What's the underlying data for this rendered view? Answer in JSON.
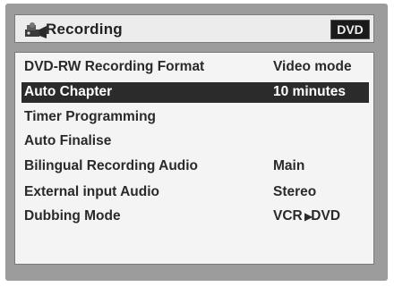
{
  "header": {
    "title": "Recording",
    "icon": "recording-menu-icon",
    "badge": "DVD"
  },
  "menu": {
    "items": [
      {
        "label": "DVD-RW Recording Format",
        "value": "Video mode",
        "selected": false
      },
      {
        "label": "Auto Chapter",
        "value": "10 minutes",
        "selected": true
      },
      {
        "label": "Timer Programming",
        "value": "",
        "selected": false
      },
      {
        "label": "Auto Finalise",
        "value": "",
        "selected": false
      },
      {
        "label": "Bilingual Recording Audio",
        "value": "Main",
        "selected": false
      },
      {
        "label": "External input Audio",
        "value": "Stereo",
        "selected": false
      },
      {
        "label": "Dubbing Mode",
        "value_prefix": "VCR",
        "value_arrow": "▶",
        "value_suffix": "DVD",
        "selected": false
      }
    ]
  },
  "colors": {
    "frame": "#9c9c9c",
    "panel": "#f4f4f4",
    "selected_row": "#2b2b2b",
    "badge_bg": "#1a1a1a"
  }
}
